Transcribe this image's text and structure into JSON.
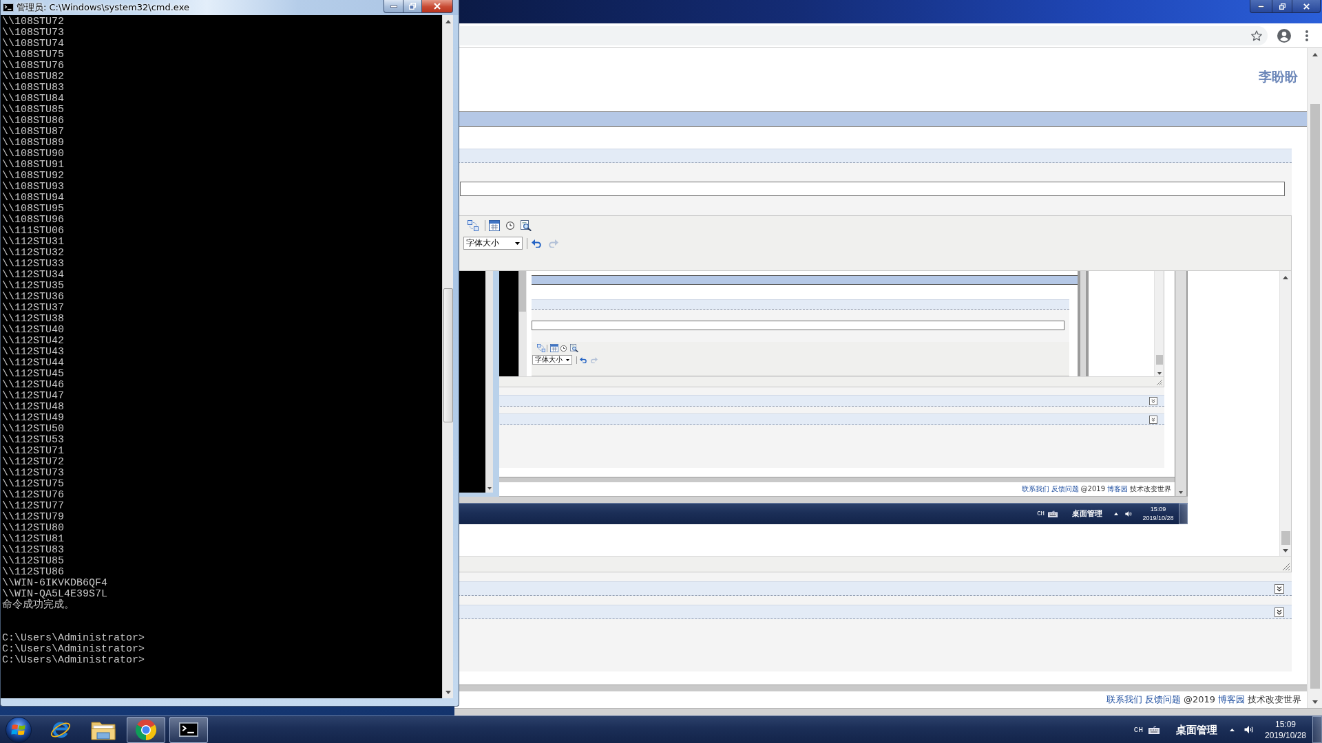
{
  "cmd_window": {
    "title": "管理员: C:\\Windows\\system32\\cmd.exe",
    "output": [
      "\\\\108STU72",
      "\\\\108STU73",
      "\\\\108STU74",
      "\\\\108STU75",
      "\\\\108STU76",
      "\\\\108STU82",
      "\\\\108STU83",
      "\\\\108STU84",
      "\\\\108STU85",
      "\\\\108STU86",
      "\\\\108STU87",
      "\\\\108STU89",
      "\\\\108STU90",
      "\\\\108STU91",
      "\\\\108STU92",
      "\\\\108STU93",
      "\\\\108STU94",
      "\\\\108STU95",
      "\\\\108STU96",
      "\\\\111STU06",
      "\\\\112STU31",
      "\\\\112STU32",
      "\\\\112STU33",
      "\\\\112STU34",
      "\\\\112STU35",
      "\\\\112STU36",
      "\\\\112STU37",
      "\\\\112STU38",
      "\\\\112STU40",
      "\\\\112STU42",
      "\\\\112STU43",
      "\\\\112STU44",
      "\\\\112STU45",
      "\\\\112STU46",
      "\\\\112STU47",
      "\\\\112STU48",
      "\\\\112STU49",
      "\\\\112STU50",
      "\\\\112STU53",
      "\\\\112STU71",
      "\\\\112STU72",
      "\\\\112STU73",
      "\\\\112STU75",
      "\\\\112STU76",
      "\\\\112STU77",
      "\\\\112STU79",
      "\\\\112STU80",
      "\\\\112STU81",
      "\\\\112STU83",
      "\\\\112STU85",
      "\\\\112STU86",
      "\\\\WIN-6IKVKDB6QF4",
      "\\\\WIN-QA5L4E39S7L"
    ],
    "message": "命令成功完成。",
    "prompts": [
      "C:\\Users\\Administrator>",
      "C:\\Users\\Administrator>",
      "C:\\Users\\Administrator>"
    ]
  },
  "browser": {
    "user_name": "李盼盼",
    "editor": {
      "font_size_select": "字体大小",
      "pasted_screenshot": {
        "nested_screenshot": {
          "font_size_select": "字体大小"
        },
        "panels": [
          {
            "expanded": false
          },
          {
            "expanded": false
          }
        ],
        "footer": [
          {
            "text": "联系我们",
            "kind": "link"
          },
          {
            "text": "反馈问题",
            "kind": "link"
          },
          {
            "text": "@2019",
            "kind": "text"
          },
          {
            "text": "博客园",
            "kind": "link"
          },
          {
            "text": "技术改变世界",
            "kind": "text"
          }
        ],
        "taskbar": {
          "language": "CH",
          "toolbar_label": "桌面管理",
          "time": "15:09",
          "date": "2019/10/28"
        }
      }
    },
    "panels": [
      {
        "expanded": false
      },
      {
        "expanded": false
      }
    ],
    "footer": [
      {
        "text": "联系我们",
        "kind": "link"
      },
      {
        "text": "反馈问题",
        "kind": "link"
      },
      {
        "text": "@2019",
        "kind": "text"
      },
      {
        "text": "博客园",
        "kind": "link"
      },
      {
        "text": "技术改变世界",
        "kind": "text"
      }
    ]
  },
  "taskbar": {
    "apps": [
      {
        "kind": "ie",
        "running": false
      },
      {
        "kind": "explorer",
        "running": false
      },
      {
        "kind": "chrome",
        "running": true
      },
      {
        "kind": "cmd",
        "running": true
      }
    ],
    "language": "CH",
    "toolbar_label": "桌面管理",
    "time": "15:09",
    "date": "2019/10/28"
  }
}
